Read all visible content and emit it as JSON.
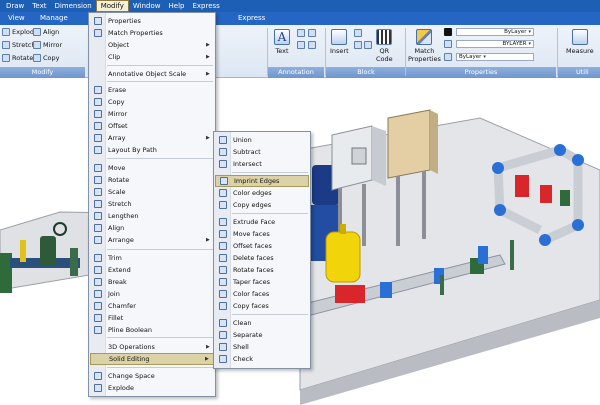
{
  "menubar": {
    "items": [
      "Draw",
      "Text",
      "Dimension",
      "Modify",
      "Window",
      "Help",
      "Express"
    ],
    "active": "Modify"
  },
  "tabs": {
    "items": [
      "View",
      "Manage",
      "Express"
    ]
  },
  "ribbon": {
    "modify_panel": {
      "title": "Modify",
      "items": [
        "Explode",
        "Align",
        "Stretch",
        "Mirror",
        "Rotate",
        "Copy"
      ]
    },
    "annotation_panel": {
      "title": "Annotation",
      "text_label": "Text"
    },
    "block_panel": {
      "title": "Block",
      "insert_label": "Insert",
      "qr_label": "QR",
      "qr_sub": "Code"
    },
    "properties_panel": {
      "title": "Properties",
      "match_label": "Match",
      "match_sub": "Properties",
      "combo_bylayer_1": "ByLayer",
      "combo_bylayer_2": "BYLAYER",
      "combo_bylayer_3": "ByLayer"
    },
    "utilities_panel": {
      "title": "Utili",
      "measure_label": "Measure"
    }
  },
  "modify_menu": {
    "items": [
      {
        "label": "Properties",
        "icon": "properties-icon",
        "arrow": false
      },
      {
        "label": "Match Properties",
        "icon": "match-properties-icon",
        "arrow": false
      },
      {
        "label": "Object",
        "icon": "",
        "arrow": true
      },
      {
        "label": "Clip",
        "icon": "",
        "arrow": true
      },
      {
        "label": "Annotative Object Scale",
        "icon": "",
        "arrow": true
      },
      {
        "label": "Erase",
        "icon": "erase-icon",
        "arrow": false
      },
      {
        "label": "Copy",
        "icon": "copy-icon",
        "arrow": false
      },
      {
        "label": "Mirror",
        "icon": "mirror-icon",
        "arrow": false
      },
      {
        "label": "Offset",
        "icon": "offset-icon",
        "arrow": false
      },
      {
        "label": "Array",
        "icon": "array-icon",
        "arrow": true
      },
      {
        "label": "Layout By Path",
        "icon": "layout-by-path-icon",
        "arrow": false
      },
      {
        "label": "Move",
        "icon": "move-icon",
        "arrow": false
      },
      {
        "label": "Rotate",
        "icon": "rotate-icon",
        "arrow": false
      },
      {
        "label": "Scale",
        "icon": "scale-icon",
        "arrow": false
      },
      {
        "label": "Stretch",
        "icon": "stretch-icon",
        "arrow": false
      },
      {
        "label": "Lengthen",
        "icon": "lengthen-icon",
        "arrow": false
      },
      {
        "label": "Align",
        "icon": "align-icon",
        "arrow": false
      },
      {
        "label": "Arrange",
        "icon": "arrange-icon",
        "arrow": true
      },
      {
        "label": "Trim",
        "icon": "trim-icon",
        "arrow": false
      },
      {
        "label": "Extend",
        "icon": "extend-icon",
        "arrow": false
      },
      {
        "label": "Break",
        "icon": "break-icon",
        "arrow": false
      },
      {
        "label": "Join",
        "icon": "join-icon",
        "arrow": false
      },
      {
        "label": "Chamfer",
        "icon": "chamfer-icon",
        "arrow": false
      },
      {
        "label": "Fillet",
        "icon": "fillet-icon",
        "arrow": false
      },
      {
        "label": "Pline Boolean",
        "icon": "pline-boolean-icon",
        "arrow": false
      },
      {
        "label": "3D Operations",
        "icon": "",
        "arrow": true
      },
      {
        "label": "Solid Editing",
        "icon": "",
        "arrow": true
      },
      {
        "label": "Change Space",
        "icon": "change-space-icon",
        "arrow": false
      },
      {
        "label": "Explode",
        "icon": "explode-icon",
        "arrow": false
      }
    ],
    "highlighted": "Solid Editing"
  },
  "solid_editing_menu": {
    "items": [
      {
        "label": "Union",
        "icon": "union-icon"
      },
      {
        "label": "Subtract",
        "icon": "subtract-icon"
      },
      {
        "label": "Intersect",
        "icon": "intersect-icon"
      },
      {
        "label": "Imprint Edges",
        "icon": "imprint-edges-icon"
      },
      {
        "label": "Color edges",
        "icon": "color-edges-icon"
      },
      {
        "label": "Copy edges",
        "icon": "copy-edges-icon"
      },
      {
        "label": "Extrude Face",
        "icon": "extrude-face-icon"
      },
      {
        "label": "Move faces",
        "icon": "move-faces-icon"
      },
      {
        "label": "Offset faces",
        "icon": "offset-faces-icon"
      },
      {
        "label": "Delete faces",
        "icon": "delete-faces-icon"
      },
      {
        "label": "Rotate faces",
        "icon": "rotate-faces-icon"
      },
      {
        "label": "Taper faces",
        "icon": "taper-faces-icon"
      },
      {
        "label": "Color faces",
        "icon": "color-faces-icon"
      },
      {
        "label": "Copy faces",
        "icon": "copy-faces-icon"
      },
      {
        "label": "Clean",
        "icon": "clean-icon"
      },
      {
        "label": "Separate",
        "icon": "separate-icon"
      },
      {
        "label": "Shell",
        "icon": "shell-icon"
      },
      {
        "label": "Check",
        "icon": "check-icon"
      }
    ],
    "highlighted": "Imprint Edges"
  },
  "colors": {
    "menubar": "#1d5fb5",
    "highlight": "#dcd2a8",
    "pipe_blue": "#2a6fd6",
    "pipe_red": "#d8262a",
    "valve_green": "#2f6b3a",
    "tank_yellow": "#f2d40a"
  }
}
